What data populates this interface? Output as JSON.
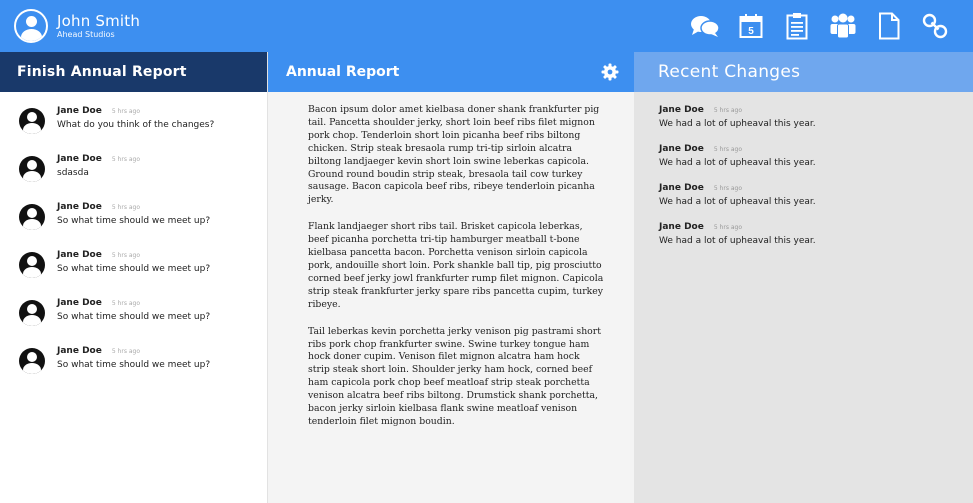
{
  "header": {
    "user_name": "John Smith",
    "user_org": "Ahead Studios",
    "icons": [
      "chat-icon",
      "calendar-icon",
      "clipboard-icon",
      "group-icon",
      "document-icon",
      "link-icon"
    ],
    "calendar_day": "5",
    "bar_color": "#3d8ff0"
  },
  "left_panel": {
    "title": "Finish Annual Report",
    "header_color": "#19396a",
    "chats": [
      {
        "author": "Jane Doe",
        "time": "5 hrs ago",
        "message": "What do you think of the changes?"
      },
      {
        "author": "Jane Doe",
        "time": "5 hrs ago",
        "message": "sdasda"
      },
      {
        "author": "Jane Doe",
        "time": "5 hrs ago",
        "message": "So what time should we meet up?"
      },
      {
        "author": "Jane Doe",
        "time": "5 hrs ago",
        "message": "So what time should we meet up?"
      },
      {
        "author": "Jane Doe",
        "time": "5 hrs ago",
        "message": "So what time should we meet up?"
      },
      {
        "author": "Jane Doe",
        "time": "5 hrs ago",
        "message": "So what time should we meet up?"
      }
    ]
  },
  "middle_panel": {
    "title": "Annual Report",
    "paragraphs": [
      "Bacon ipsum dolor amet kielbasa doner shank frankfurter pig tail. Pancetta shoulder jerky, short loin beef ribs filet mignon pork chop. Tenderloin short loin picanha beef ribs biltong chicken. Strip steak bresaola rump tri-tip sirloin alcatra biltong landjaeger kevin short loin swine leberkas capicola. Ground round boudin strip steak, bresaola tail cow turkey sausage. Bacon capicola beef ribs, ribeye tenderloin picanha jerky.",
      "Flank landjaeger short ribs tail. Brisket capicola leberkas, beef picanha porchetta tri-tip hamburger meatball t-bone kielbasa pancetta bacon. Porchetta venison sirloin capicola pork, andouille short loin. Pork shankle ball tip, pig prosciutto corned beef jerky jowl frankfurter rump filet mignon. Capicola strip steak frankfurter jerky spare ribs pancetta cupim, turkey ribeye.",
      "Tail leberkas kevin porchetta jerky venison pig pastrami short ribs pork chop frankfurter swine. Swine turkey tongue ham hock doner cupim. Venison filet mignon alcatra ham hock strip steak short loin. Shoulder jerky ham hock, corned beef ham capicola pork chop beef meatloaf strip steak porchetta venison alcatra beef ribs biltong. Drumstick shank porchetta, bacon jerky sirloin kielbasa flank swine meatloaf venison tenderloin filet mignon boudin."
    ]
  },
  "right_panel": {
    "title": "Recent Changes",
    "changes": [
      {
        "author": "Jane Doe",
        "time": "5 hrs ago",
        "message": "We had a lot of upheaval this year."
      },
      {
        "author": "Jane Doe",
        "time": "5 hrs ago",
        "message": "We had a lot of upheaval this year."
      },
      {
        "author": "Jane Doe",
        "time": "5 hrs ago",
        "message": "We had a lot of upheaval this year."
      },
      {
        "author": "Jane Doe",
        "time": "5 hrs ago",
        "message": "We had a lot of upheaval this year."
      }
    ]
  }
}
